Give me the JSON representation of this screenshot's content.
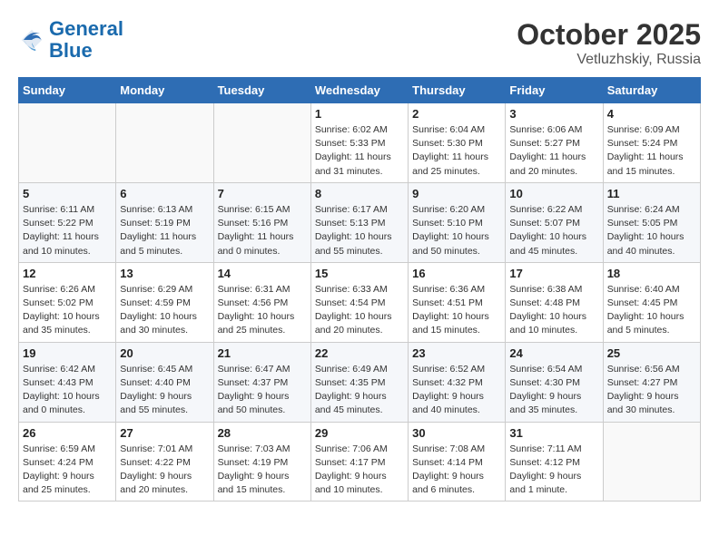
{
  "logo": {
    "line1": "General",
    "line2": "Blue"
  },
  "title": "October 2025",
  "subtitle": "Vetluzhskiy, Russia",
  "days_of_week": [
    "Sunday",
    "Monday",
    "Tuesday",
    "Wednesday",
    "Thursday",
    "Friday",
    "Saturday"
  ],
  "weeks": [
    [
      {
        "day": "",
        "info": ""
      },
      {
        "day": "",
        "info": ""
      },
      {
        "day": "",
        "info": ""
      },
      {
        "day": "1",
        "info": "Sunrise: 6:02 AM\nSunset: 5:33 PM\nDaylight: 11 hours\nand 31 minutes."
      },
      {
        "day": "2",
        "info": "Sunrise: 6:04 AM\nSunset: 5:30 PM\nDaylight: 11 hours\nand 25 minutes."
      },
      {
        "day": "3",
        "info": "Sunrise: 6:06 AM\nSunset: 5:27 PM\nDaylight: 11 hours\nand 20 minutes."
      },
      {
        "day": "4",
        "info": "Sunrise: 6:09 AM\nSunset: 5:24 PM\nDaylight: 11 hours\nand 15 minutes."
      }
    ],
    [
      {
        "day": "5",
        "info": "Sunrise: 6:11 AM\nSunset: 5:22 PM\nDaylight: 11 hours\nand 10 minutes."
      },
      {
        "day": "6",
        "info": "Sunrise: 6:13 AM\nSunset: 5:19 PM\nDaylight: 11 hours\nand 5 minutes."
      },
      {
        "day": "7",
        "info": "Sunrise: 6:15 AM\nSunset: 5:16 PM\nDaylight: 11 hours\nand 0 minutes."
      },
      {
        "day": "8",
        "info": "Sunrise: 6:17 AM\nSunset: 5:13 PM\nDaylight: 10 hours\nand 55 minutes."
      },
      {
        "day": "9",
        "info": "Sunrise: 6:20 AM\nSunset: 5:10 PM\nDaylight: 10 hours\nand 50 minutes."
      },
      {
        "day": "10",
        "info": "Sunrise: 6:22 AM\nSunset: 5:07 PM\nDaylight: 10 hours\nand 45 minutes."
      },
      {
        "day": "11",
        "info": "Sunrise: 6:24 AM\nSunset: 5:05 PM\nDaylight: 10 hours\nand 40 minutes."
      }
    ],
    [
      {
        "day": "12",
        "info": "Sunrise: 6:26 AM\nSunset: 5:02 PM\nDaylight: 10 hours\nand 35 minutes."
      },
      {
        "day": "13",
        "info": "Sunrise: 6:29 AM\nSunset: 4:59 PM\nDaylight: 10 hours\nand 30 minutes."
      },
      {
        "day": "14",
        "info": "Sunrise: 6:31 AM\nSunset: 4:56 PM\nDaylight: 10 hours\nand 25 minutes."
      },
      {
        "day": "15",
        "info": "Sunrise: 6:33 AM\nSunset: 4:54 PM\nDaylight: 10 hours\nand 20 minutes."
      },
      {
        "day": "16",
        "info": "Sunrise: 6:36 AM\nSunset: 4:51 PM\nDaylight: 10 hours\nand 15 minutes."
      },
      {
        "day": "17",
        "info": "Sunrise: 6:38 AM\nSunset: 4:48 PM\nDaylight: 10 hours\nand 10 minutes."
      },
      {
        "day": "18",
        "info": "Sunrise: 6:40 AM\nSunset: 4:45 PM\nDaylight: 10 hours\nand 5 minutes."
      }
    ],
    [
      {
        "day": "19",
        "info": "Sunrise: 6:42 AM\nSunset: 4:43 PM\nDaylight: 10 hours\nand 0 minutes."
      },
      {
        "day": "20",
        "info": "Sunrise: 6:45 AM\nSunset: 4:40 PM\nDaylight: 9 hours\nand 55 minutes."
      },
      {
        "day": "21",
        "info": "Sunrise: 6:47 AM\nSunset: 4:37 PM\nDaylight: 9 hours\nand 50 minutes."
      },
      {
        "day": "22",
        "info": "Sunrise: 6:49 AM\nSunset: 4:35 PM\nDaylight: 9 hours\nand 45 minutes."
      },
      {
        "day": "23",
        "info": "Sunrise: 6:52 AM\nSunset: 4:32 PM\nDaylight: 9 hours\nand 40 minutes."
      },
      {
        "day": "24",
        "info": "Sunrise: 6:54 AM\nSunset: 4:30 PM\nDaylight: 9 hours\nand 35 minutes."
      },
      {
        "day": "25",
        "info": "Sunrise: 6:56 AM\nSunset: 4:27 PM\nDaylight: 9 hours\nand 30 minutes."
      }
    ],
    [
      {
        "day": "26",
        "info": "Sunrise: 6:59 AM\nSunset: 4:24 PM\nDaylight: 9 hours\nand 25 minutes."
      },
      {
        "day": "27",
        "info": "Sunrise: 7:01 AM\nSunset: 4:22 PM\nDaylight: 9 hours\nand 20 minutes."
      },
      {
        "day": "28",
        "info": "Sunrise: 7:03 AM\nSunset: 4:19 PM\nDaylight: 9 hours\nand 15 minutes."
      },
      {
        "day": "29",
        "info": "Sunrise: 7:06 AM\nSunset: 4:17 PM\nDaylight: 9 hours\nand 10 minutes."
      },
      {
        "day": "30",
        "info": "Sunrise: 7:08 AM\nSunset: 4:14 PM\nDaylight: 9 hours\nand 6 minutes."
      },
      {
        "day": "31",
        "info": "Sunrise: 7:11 AM\nSunset: 4:12 PM\nDaylight: 9 hours\nand 1 minute."
      },
      {
        "day": "",
        "info": ""
      }
    ]
  ]
}
